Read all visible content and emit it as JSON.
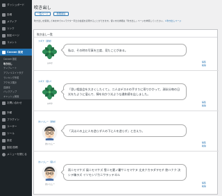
{
  "sidebar": {
    "items": [
      {
        "label": "ダッシュボード",
        "icon": "dashboard-icon"
      },
      {
        "label": "投稿",
        "icon": "pin-icon"
      },
      {
        "label": "メディア",
        "icon": "media-icon"
      },
      {
        "label": "リンク",
        "icon": "link-icon"
      },
      {
        "label": "固定ページ",
        "icon": "page-icon"
      },
      {
        "label": "コメント",
        "icon": "comment-icon"
      }
    ],
    "active": {
      "label": "Cocoon 設定",
      "icon": "cocoon-icon"
    },
    "submenu": [
      "Cocoon 設定",
      "吹き出し",
      "テンプレート",
      "アフィリエイトタグ",
      "ランキング作成",
      "アクセス集計",
      "高速化",
      "バックアップ",
      "キャッシュ削除"
    ],
    "items_after": [
      {
        "label": "お問い合わせ",
        "icon": "mail-icon"
      },
      {
        "label": "外観",
        "icon": "brush-icon"
      },
      {
        "label": "プラグイン",
        "icon": "plugin-icon"
      },
      {
        "label": "ユーザー",
        "icon": "user-icon"
      },
      {
        "label": "ツール",
        "icon": "wrench-icon"
      },
      {
        "label": "設定",
        "icon": "settings-icon"
      },
      {
        "label": "固定/投稿",
        "icon": "list-icon"
      }
    ],
    "collapse": {
      "label": "メニューを閉じる",
      "icon": "collapse-icon"
    }
  },
  "header": {
    "title": "吹き出し",
    "list_button": "一覧ページ",
    "new_button": "新規追加"
  },
  "description": {
    "text": "吹き出しを使用して本文中でキャラクター同士の会話を表現することができます。使い方の詳細は「吹き出し」ページを参照してください。",
    "link": "ℹ 吹き出しページ"
  },
  "panel": {
    "title": "吹き出し一覧",
    "rows": [
      {
        "name": "スギナ（通常）",
        "speaker": "スギナ",
        "text": "私は、その時の写真を三度、見たことがある。",
        "avatar": "plant",
        "edit": "編集",
        "delete": "削除"
      },
      {
        "name": "スギナ（思い）",
        "speaker": "スギナ",
        "text": "「思い相談会を大きくしたくて」、二人はデスキの手すりに寄りかかって、顔半分毎の日光をたように溜んで、陣を向かう光ような違和感を出しました。",
        "avatar": "plant",
        "edit": "編集",
        "delete": "削除"
      },
      {
        "name": "まいっしー（通常）",
        "speaker": "まいっしー",
        "text": "「天は人の上に人を造らず人の下に人を造らず」と言えり。",
        "avatar": "boy",
        "edit": "編集",
        "delete": "削除"
      },
      {
        "name": "まいっしー（思い）",
        "speaker": "まいっしー",
        "text": "雨ニモマケズ 風ニモマケズ 雪ニモ夏ノ暑サニモマケヌ 丈夫ナカラダヲモチ 慾ハナク 決シテ瞋ラズ イツモシヅカニワラッテヰル",
        "avatar": "boy",
        "edit": "編集",
        "delete": "削除"
      }
    ]
  },
  "colors": {
    "sidebar_bg": "#1d2327",
    "accent": "#2271b1",
    "page_bg": "#f0f0f1"
  }
}
